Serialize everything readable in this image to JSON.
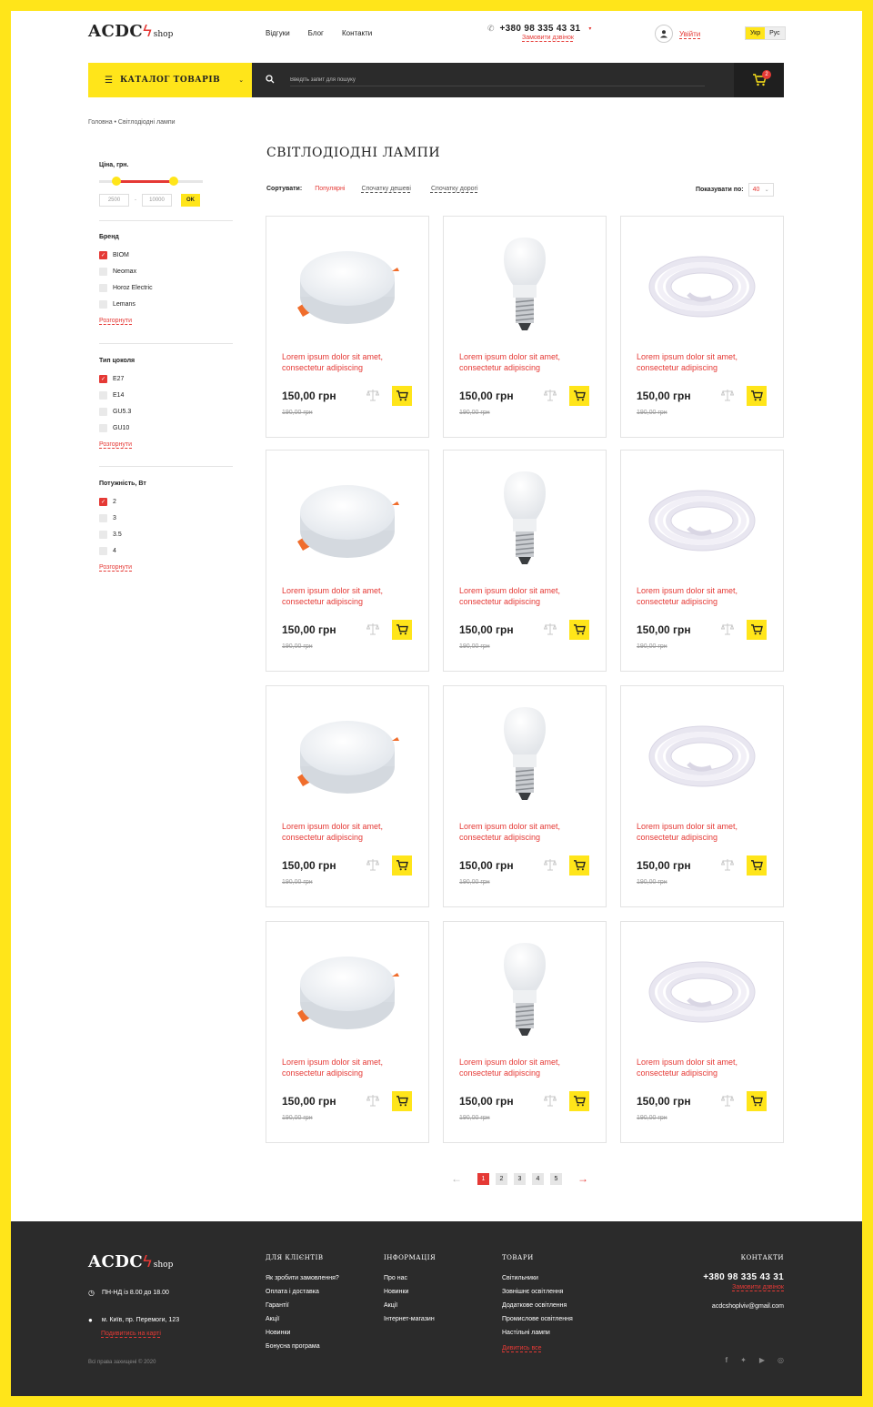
{
  "header": {
    "logo": "ACDC",
    "logo_suffix": "shop",
    "nav": [
      "Відгуки",
      "Блог",
      "Контакти"
    ],
    "phone": "+380 98 335 43 31",
    "callback": "Замовити дзвінок",
    "login": "Увійти",
    "lang": [
      "Укр",
      "Рус"
    ]
  },
  "toolbar": {
    "catalog_label": "КАТАЛОГ ТОВАРІВ",
    "search_placeholder": "Введіть запит для пошуку",
    "cart_count": "2"
  },
  "breadcrumb": "Головна • Світлодіодні лампи",
  "page_title": "СВІТЛОДІОДНІ ЛАМПИ",
  "filters": {
    "price": {
      "title": "Ціна, грн.",
      "min": "2500",
      "max": "10000",
      "sep": "-",
      "ok": "OK"
    },
    "groups": [
      {
        "title": "Бренд",
        "items": [
          {
            "label": "BIOM",
            "checked": true
          },
          {
            "label": "Neomax",
            "checked": false
          },
          {
            "label": "Horoz Electric",
            "checked": false
          },
          {
            "label": "Lemans",
            "checked": false
          }
        ],
        "expand": "Розгорнути"
      },
      {
        "title": "Тип цоколя",
        "items": [
          {
            "label": "E27",
            "checked": true
          },
          {
            "label": "E14",
            "checked": false
          },
          {
            "label": "GU5.3",
            "checked": false
          },
          {
            "label": "GU10",
            "checked": false
          }
        ],
        "expand": "Розгорнути"
      },
      {
        "title": "Потужність, Вт",
        "items": [
          {
            "label": "2",
            "checked": true
          },
          {
            "label": "3",
            "checked": false
          },
          {
            "label": "3.5",
            "checked": false
          },
          {
            "label": "4",
            "checked": false
          }
        ],
        "expand": "Розгорнути"
      }
    ]
  },
  "sort": {
    "label": "Сортувати:",
    "options": [
      "Популярні",
      "Спочатку дешеві",
      "Спочатку дорогі"
    ],
    "per_page_label": "Показувати по:",
    "per_page": "40"
  },
  "products": [
    {
      "type": "panel",
      "title": "Lorem ipsum dolor sit amet, consectetur adipiscing",
      "price": "150,00 грн",
      "old_price": "190,00 грн"
    },
    {
      "type": "bulb",
      "title": "Lorem ipsum dolor sit amet, consectetur adipiscing",
      "price": "150,00 грн",
      "old_price": "190,00 грн"
    },
    {
      "type": "strip",
      "title": "Lorem ipsum dolor sit amet, consectetur adipiscing",
      "price": "150,00 грн",
      "old_price": "190,00 грн"
    },
    {
      "type": "panel",
      "title": "Lorem ipsum dolor sit amet, consectetur adipiscing",
      "price": "150,00 грн",
      "old_price": "190,00 грн"
    },
    {
      "type": "bulb",
      "title": "Lorem ipsum dolor sit amet, consectetur adipiscing",
      "price": "150,00 грн",
      "old_price": "190,00 грн"
    },
    {
      "type": "strip",
      "title": "Lorem ipsum dolor sit amet, consectetur adipiscing",
      "price": "150,00 грн",
      "old_price": "190,00 грн"
    },
    {
      "type": "panel",
      "title": "Lorem ipsum dolor sit amet, consectetur adipiscing",
      "price": "150,00 грн",
      "old_price": "190,00 грн"
    },
    {
      "type": "bulb",
      "title": "Lorem ipsum dolor sit amet, consectetur adipiscing",
      "price": "150,00 грн",
      "old_price": "190,00 грн"
    },
    {
      "type": "strip",
      "title": "Lorem ipsum dolor sit amet, consectetur adipiscing",
      "price": "150,00 грн",
      "old_price": "190,00 грн"
    },
    {
      "type": "panel",
      "title": "Lorem ipsum dolor sit amet, consectetur adipiscing",
      "price": "150,00 грн",
      "old_price": "190,00 грн"
    },
    {
      "type": "bulb",
      "title": "Lorem ipsum dolor sit amet, consectetur adipiscing",
      "price": "150,00 грн",
      "old_price": "190,00 грн"
    },
    {
      "type": "strip",
      "title": "Lorem ipsum dolor sit amet, consectetur adipiscing",
      "price": "150,00 грн",
      "old_price": "190,00 грн"
    }
  ],
  "pagination": {
    "pages": [
      "1",
      "2",
      "3",
      "4",
      "5"
    ],
    "current": "1"
  },
  "footer": {
    "hours": "ПН-НД із 8.00 до 18.00",
    "address": "м. Київ, пр. Перемоги, 123",
    "map_link": "Подивитись на карті",
    "copyright": "Всі права захищені © 2020",
    "columns": [
      {
        "title": "ДЛЯ КЛІЄНТІВ",
        "links": [
          "Як зробити замовлення?",
          "Оплата і доставка",
          "Гарантії",
          "Акції",
          "Новинки",
          "Бонусна програма"
        ]
      },
      {
        "title": "ІНФОРМАЦІЯ",
        "links": [
          "Про нас",
          "Новинки",
          "Акції",
          "Інтернет-магазин"
        ]
      },
      {
        "title": "ТОВАРИ",
        "links": [
          "Світильники",
          "Зовнішнє освітлення",
          "Додаткове освітлення",
          "Промислове освітлення",
          "Настільні лампи"
        ],
        "more": "Дивитись все"
      }
    ],
    "contacts_title": "КОНТАКТИ",
    "phone": "+380 98 335 43 31",
    "callback": "Замовити дзвінок",
    "email": "acdcshoplviv@gmail.com",
    "socials": [
      "facebook-icon",
      "twitter-icon",
      "youtube-icon",
      "instagram-icon"
    ]
  },
  "colors": {
    "accent": "#ffe51a",
    "brand_red": "#e53935",
    "dark": "#2b2b2b"
  }
}
